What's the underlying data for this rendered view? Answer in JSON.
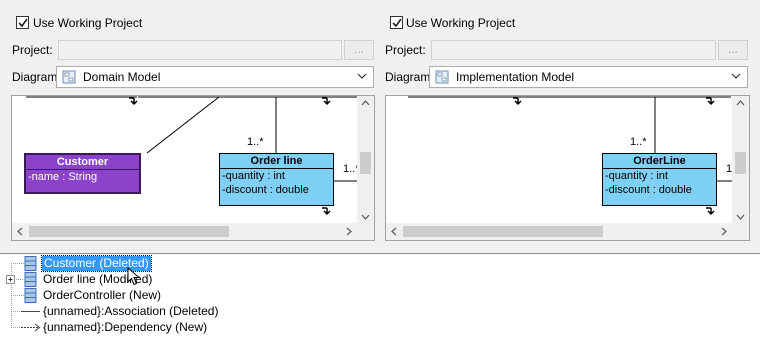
{
  "left": {
    "use_working_project_label": "Use Working Project",
    "project_label": "Project:",
    "project_value": "",
    "browse_label": "...",
    "diagram_label": "Diagram:",
    "diagram_value": "Domain Model",
    "diagram": {
      "class_a": {
        "name": "Customer",
        "attrs": [
          "-name : String"
        ],
        "color": "#8b43c9"
      },
      "class_b": {
        "name": "Order line",
        "attrs": [
          "-quantity : int",
          "-discount : double"
        ],
        "color": "#7fd0f5"
      },
      "mult_top": "1..*",
      "mult_right": "1..*"
    }
  },
  "right": {
    "use_working_project_label": "Use Working Project",
    "project_label": "Project:",
    "project_value": "",
    "browse_label": "...",
    "diagram_label": "Diagram:",
    "diagram_value": "Implementation Model",
    "diagram": {
      "class_b": {
        "name": "OrderLine",
        "attrs": [
          "-quantity : int",
          "-discount : double"
        ],
        "color": "#7fd0f5"
      },
      "mult_top": "1..*",
      "mult_right": "1"
    }
  },
  "tree": {
    "items": [
      {
        "label": "Customer (Deleted)",
        "icon": "class-icon",
        "selected": true
      },
      {
        "label": "Order line (Modified)",
        "icon": "class-icon",
        "selected": false
      },
      {
        "label": "OrderController (New)",
        "icon": "class-icon",
        "selected": false
      },
      {
        "label": "{unnamed}:Association (Deleted)",
        "icon": "association-icon",
        "selected": false
      },
      {
        "label": "{unnamed}:Dependency (New)",
        "icon": "dependency-icon",
        "selected": false
      }
    ],
    "selection_color": "#3399ff"
  }
}
